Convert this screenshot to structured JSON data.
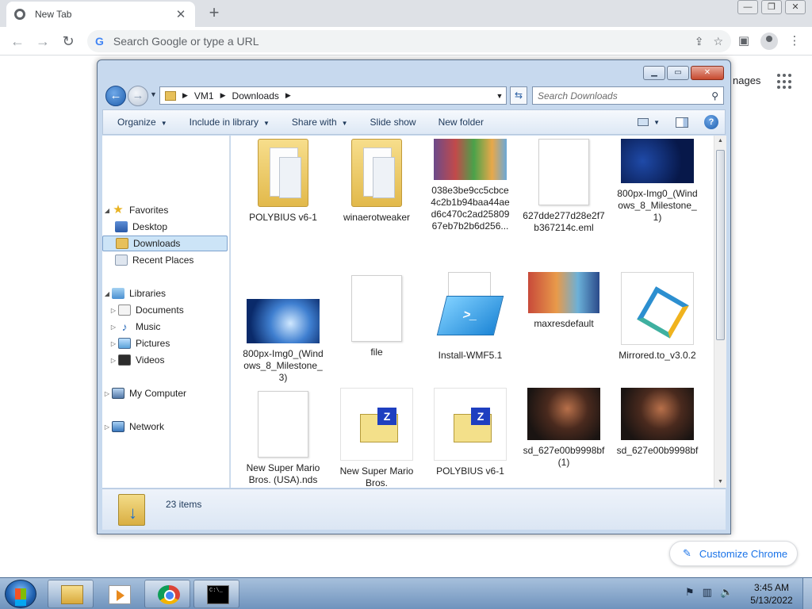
{
  "chrome": {
    "tab_title": "New Tab",
    "omnibox_placeholder": "Search Google or type a URL",
    "images_link": "nages",
    "customize_label": "Customize Chrome"
  },
  "explorer": {
    "breadcrumb": [
      "VM1",
      "Downloads"
    ],
    "search_placeholder": "Search Downloads",
    "commands": [
      "Organize",
      "Include in library",
      "Share with",
      "Slide show",
      "New folder"
    ],
    "nav": {
      "favorites": "Favorites",
      "desktop": "Desktop",
      "downloads": "Downloads",
      "recent_places": "Recent Places",
      "libraries": "Libraries",
      "documents": "Documents",
      "music": "Music",
      "pictures": "Pictures",
      "videos": "Videos",
      "my_computer": "My Computer",
      "network": "Network"
    },
    "files": [
      {
        "name": "POLYBIUS v6-1",
        "kind": "folder"
      },
      {
        "name": "winaerotweaker",
        "kind": "folder"
      },
      {
        "name": "038e3be9cc5cbce4c2b1b94baa44aed6c470c2ad2580967eb7b2b6d256...",
        "kind": "image-cartoon"
      },
      {
        "name": "627dde277d28e2f7b367214c.eml",
        "kind": "blank"
      },
      {
        "name": "800px-Img0_(Windows_8_Milestone_1)",
        "kind": "image-dark-blue"
      },
      {
        "name": "800px-Img0_(Windows_8_Milestone_3)",
        "kind": "image-light-blue"
      },
      {
        "name": "file",
        "kind": "blank"
      },
      {
        "name": "Install-WMF5.1",
        "kind": "powershell"
      },
      {
        "name": "maxresdefault",
        "kind": "image-cartoon"
      },
      {
        "name": "Mirrored.to_v3.0.2",
        "kind": "installer"
      },
      {
        "name": "New Super Mario Bros. (USA).nds",
        "kind": "blank"
      },
      {
        "name": "New Super Mario Bros.",
        "kind": "zip"
      },
      {
        "name": "POLYBIUS v6-1",
        "kind": "zip"
      },
      {
        "name": "sd_627e00b9998bf (1)",
        "kind": "image-photo"
      },
      {
        "name": "sd_627e00b9998bf",
        "kind": "image-photo"
      }
    ],
    "item_count": "23 items"
  },
  "taskbar": {
    "time": "3:45 AM",
    "date": "5/13/2022"
  }
}
